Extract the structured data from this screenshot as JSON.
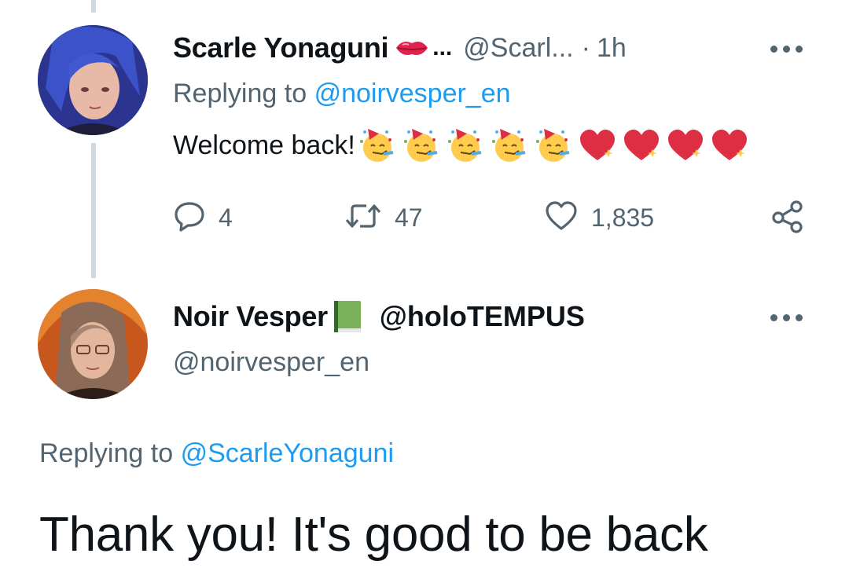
{
  "tweet1": {
    "display_name": "Scarle Yonaguni",
    "name_icon": "kiss-mark-emoji",
    "name_ellipsis": "...",
    "handle": "@Scarl...",
    "separator": "·",
    "time": "1h",
    "replying_prefix": "Replying to",
    "replying_mention": "@noirvesper_en",
    "text": "Welcome back!",
    "emojis": [
      "partying-face",
      "partying-face",
      "partying-face",
      "partying-face",
      "partying-face",
      "sparkling-heart",
      "sparkling-heart",
      "sparkling-heart",
      "sparkling-heart"
    ],
    "replies": "4",
    "retweets": "47",
    "likes": "1,835"
  },
  "tweet2": {
    "display_name": "Noir Vesper",
    "name_icon": "green-book-emoji",
    "name_suffix": "@holoTEMPUS",
    "handle": "@noirvesper_en",
    "replying_prefix": "Replying to",
    "replying_mention": "@ScarleYonaguni",
    "text": "Thank you! It's good to be back"
  },
  "colors": {
    "accent": "#1d9bf0",
    "secondary_text": "#536471",
    "primary_text": "#0f1419",
    "thread_line": "#cfd9de"
  }
}
